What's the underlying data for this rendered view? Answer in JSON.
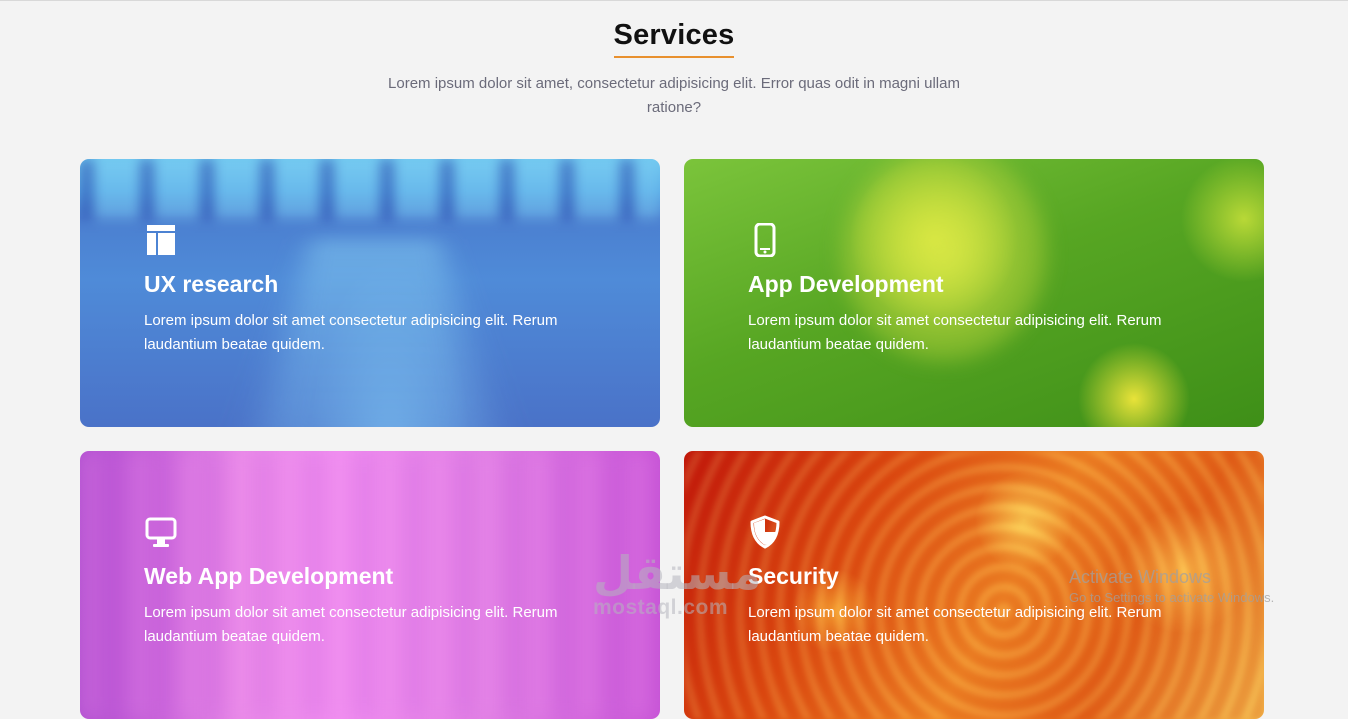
{
  "section": {
    "title": "Services",
    "subtitle": "Lorem ipsum dolor sit amet, consectetur adipisicing elit. Error quas odit in magni ullam ratione?",
    "accent_color": "#e8902e"
  },
  "services": [
    {
      "title": "UX research",
      "description": "Lorem ipsum dolor sit amet consectetur adipisicing elit. Rerum laudantium beatae quidem.",
      "icon": "layout-icon"
    },
    {
      "title": "App Development",
      "description": "Lorem ipsum dolor sit amet consectetur adipisicing elit. Rerum laudantium beatae quidem.",
      "icon": "mobile-phone-icon"
    },
    {
      "title": "Web App Development",
      "description": "Lorem ipsum dolor sit amet consectetur adipisicing elit. Rerum laudantium beatae quidem.",
      "icon": "desktop-monitor-icon"
    },
    {
      "title": "Security",
      "description": "Lorem ipsum dolor sit amet consectetur adipisicing elit. Rerum laudantium beatae quidem.",
      "icon": "shield-icon"
    }
  ],
  "watermark": {
    "brand_arabic": "مستقل",
    "brand_latin": "mostaql.com"
  },
  "os_notice": {
    "title": "Activate Windows",
    "message": "Go to Settings to activate Windows."
  }
}
